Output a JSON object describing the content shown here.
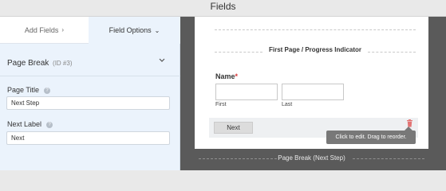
{
  "header": {
    "title": "Fields"
  },
  "tabs": [
    {
      "label": "Add Fields",
      "chevron": "›"
    },
    {
      "label": "Field Options",
      "chevron": "⌄"
    }
  ],
  "field_options": {
    "field_name": "Page Break",
    "field_id": "(ID #3)",
    "page_title_label": "Page Title",
    "page_title_value": "Next Step",
    "next_label_label": "Next Label",
    "next_label_value": "Next",
    "help_icon": "?"
  },
  "preview": {
    "progress_title": "First Page / Progress Indicator",
    "name_label": "Name",
    "required_mark": "*",
    "first_sublabel": "First",
    "last_sublabel": "Last",
    "next_button": "Next",
    "tooltip": "Click to edit. Drag to reorder.",
    "page_break_label": "Page Break (Next Step)"
  },
  "colors": {
    "panel_bg": "#ebf3fc",
    "dark_stripe": "#5a5a5a",
    "required": "#d63638",
    "trash": "#e27474"
  },
  "icons": {
    "collapse": "chevron-down-icon",
    "help": "help-icon",
    "delete": "trash-icon"
  }
}
